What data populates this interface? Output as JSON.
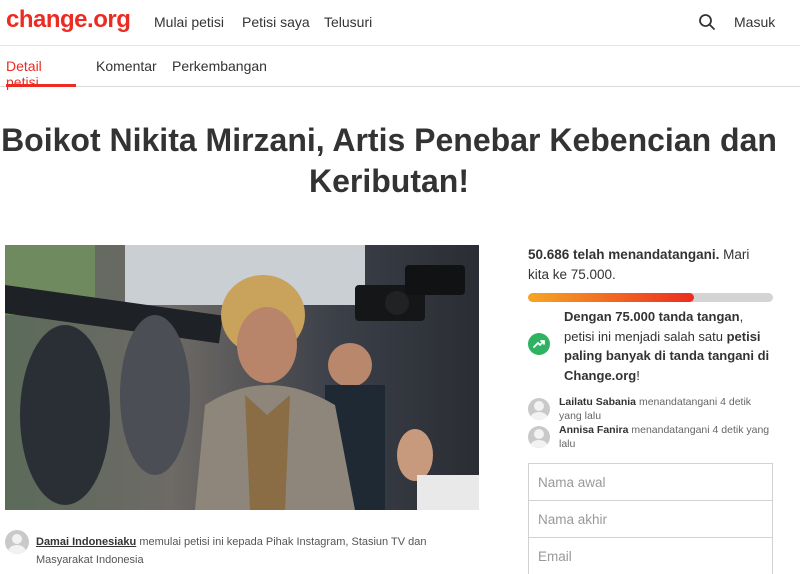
{
  "header": {
    "logo": "change.org",
    "nav": [
      "Mulai petisi",
      "Petisi saya",
      "Telusuri"
    ],
    "login": "Masuk"
  },
  "tabs": [
    "Detail petisi",
    "Komentar",
    "Perkembangan"
  ],
  "petition": {
    "title": "Boikot Nikita Mirzani, Artis Penebar Kebencian dan Keributan!"
  },
  "creator": {
    "name": "Damai Indonesiaku",
    "text": " memulai petisi ini kepada Pihak Instagram, Stasiun TV dan Masyarakat Indonesia"
  },
  "signatures": {
    "count_bold": "50.686 telah menandatangani.",
    "goal_text": " Mari kita ke 75.000.",
    "progress_fraction": 0.6758
  },
  "milestone": {
    "bold1": "Dengan 75.000 tanda tangan",
    "text1": ", petisi ini menjadi salah satu ",
    "bold2": "petisi paling banyak di tanda tangani di Change.org",
    "text2": "!"
  },
  "recent_signers": [
    {
      "name": "Lailatu Sabania",
      "text": " menandatangani 4 detik yang lalu"
    },
    {
      "name": "Annisa Fanira",
      "text": " menandatangani 4 detik yang lalu"
    }
  ],
  "form": {
    "first_name_placeholder": "Nama awal",
    "last_name_placeholder": "Nama akhir",
    "email_placeholder": "Email"
  },
  "colors": {
    "brand": "#ec2c22",
    "progress_start": "#f5a623",
    "progress_end": "#ec2c22",
    "milestone_icon": "#2fb262"
  },
  "icons": {
    "search": "search-icon",
    "milestone": "trending-up-icon",
    "avatar": "user-avatar-icon"
  }
}
